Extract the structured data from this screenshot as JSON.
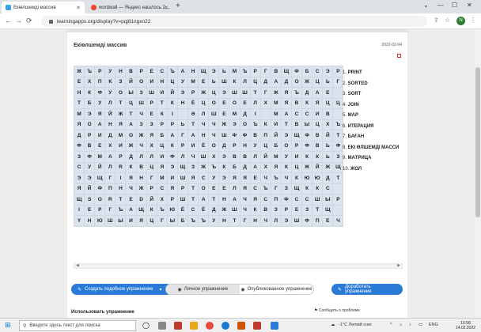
{
  "tabs": [
    {
      "title": "Екiөлшемдi массив",
      "active": true
    },
    {
      "title": "wordwall — Яндекс нашлось 2…",
      "active": false
    }
  ],
  "address": "learningapps.org/display?v=pqj81ngxn22",
  "avatar_letter": "N",
  "exercise": {
    "title": "Екiөлшемдi массив",
    "date": "2022-02-04"
  },
  "grid": [
    [
      "Ж",
      "Ъ",
      "Р",
      "У",
      "Н",
      "В",
      "Р",
      "Е",
      "С",
      "Ъ",
      "А",
      "Н",
      "Щ",
      "Э",
      "Ь",
      "М",
      "Ъ",
      "Р",
      "Г",
      "В",
      "Щ",
      "Ф",
      "Б",
      "С",
      "Э",
      "Р"
    ],
    [
      "Е",
      "Х",
      "П",
      "К",
      "З",
      "Й",
      "О",
      "И",
      "Н",
      "Ц",
      "У",
      "М",
      "Е",
      "Ь",
      "Ш",
      "К",
      "Л",
      "Ц",
      "Д",
      "А",
      "Д",
      "О",
      "Ж",
      "Ц",
      "Ь",
      "Г"
    ],
    [
      "Н",
      "К",
      "Ф",
      "У",
      "О",
      "Ы",
      "З",
      "Ш",
      "И",
      "Й",
      "Э",
      "Р",
      "Ж",
      "Ц",
      "Э",
      "Ш",
      "Ш",
      "Т",
      "Г",
      "Ж",
      "Я",
      "Ъ",
      "Д",
      "А",
      "Е",
      ""
    ],
    [
      "Т",
      "Б",
      "У",
      "Л",
      "Т",
      "Ц",
      "Ш",
      "Р",
      "Т",
      "К",
      "Н",
      "Ё",
      "Ц",
      "О",
      "Е",
      "О",
      "Е",
      "Л",
      "Х",
      "М",
      "Я",
      "В",
      "К",
      "Я",
      "Ц",
      "Ц"
    ],
    [
      "М",
      "Э",
      "Я",
      "Й",
      "Ж",
      "Т",
      "Ч",
      "Е",
      "К",
      "І",
      "",
      "Ә",
      "Л",
      "Ш",
      "Е",
      "М",
      "Д",
      "І",
      "",
      "М",
      "А",
      "С",
      "С",
      "И",
      "В",
      ""
    ],
    [
      "Я",
      "О",
      "А",
      "Н",
      "Я",
      "А",
      "З",
      "З",
      "Р",
      "Р",
      "Ь",
      "Т",
      "Ч",
      "Ч",
      "Ж",
      "Э",
      "О",
      "Ъ",
      "К",
      "И",
      "Т",
      "В",
      "Ы",
      "Ц",
      "Х",
      "Ъ"
    ],
    [
      "Д",
      "Р",
      "И",
      "Д",
      "М",
      "О",
      "Ж",
      "Я",
      "Б",
      "А",
      "Г",
      "А",
      "Н",
      "Ч",
      "Ш",
      "Ф",
      "Ф",
      "В",
      "П",
      "Й",
      "Э",
      "Щ",
      "Ф",
      "В",
      "Й",
      "Т"
    ],
    [
      "Ф",
      "В",
      "Е",
      "Х",
      "И",
      "Ж",
      "Ч",
      "Х",
      "Ц",
      "К",
      "Р",
      "И",
      "Ё",
      "О",
      "Д",
      "Р",
      "Н",
      "У",
      "Ц",
      "Б",
      "О",
      "Р",
      "Ф",
      "В",
      "Ь",
      "Ф"
    ],
    [
      "З",
      "Ф",
      "М",
      "А",
      "Р",
      "Д",
      "Л",
      "Л",
      "И",
      "Ф",
      "Л",
      "Ч",
      "Ш",
      "Х",
      "Э",
      "В",
      "В",
      "Л",
      "Й",
      "М",
      "У",
      "И",
      "К",
      "К",
      "Ь",
      "З"
    ],
    [
      "С",
      "У",
      "Й",
      "Л",
      "R",
      "К",
      "В",
      "Ц",
      "Я",
      "Э",
      "Щ",
      "З",
      "Ж",
      "Ъ",
      "К",
      "Б",
      "Д",
      "А",
      "Х",
      "Я",
      "К",
      "Ц",
      "Ж",
      "Й",
      "Ж",
      "Щ"
    ],
    [
      "Э",
      "Э",
      "Щ",
      "Г",
      "І",
      "Я",
      "Н",
      "Г",
      "М",
      "И",
      "Ш",
      "Я",
      "С",
      "У",
      "Э",
      "Я",
      "Я",
      "Е",
      "Ч",
      "Ъ",
      "Ч",
      "К",
      "Ю",
      "Ю",
      "Д",
      "Т"
    ],
    [
      "Я",
      "Й",
      "Ф",
      "П",
      "Н",
      "Ч",
      "Ж",
      "Р",
      "С",
      "Я",
      "Р",
      "Т",
      "О",
      "Е",
      "Е",
      "Л",
      "Я",
      "С",
      "Ъ",
      "Г",
      "З",
      "Щ",
      "К",
      "К",
      "С",
      ""
    ],
    [
      "Щ",
      "S",
      "O",
      "R",
      "T",
      "E",
      "D",
      "Й",
      "Х",
      "Р",
      "Ш",
      "Т",
      "А",
      "Т",
      "Н",
      "А",
      "Ч",
      "Я",
      "С",
      "П",
      "Ф",
      "С",
      "С",
      "Ш",
      "Ы",
      "Р"
    ],
    [
      "І",
      "Е",
      "Р",
      "Г",
      "Ъ",
      "А",
      "Щ",
      "К",
      "Ъ",
      "Ю",
      "Ё",
      "С",
      "Ё",
      "Д",
      "Ж",
      "Ш",
      "Ч",
      "К",
      "В",
      "З",
      "Р",
      "Е",
      "З",
      "Т",
      "Щ",
      ""
    ],
    [
      "Ү",
      "Н",
      "Ю",
      "Ш",
      "Ы",
      "И",
      "Я",
      "Ц",
      "Г",
      "Ы",
      "Б",
      "Ъ",
      "Ъ",
      "У",
      "Н",
      "Т",
      "Г",
      "Н",
      "Ч",
      "Л",
      "Э",
      "Ш",
      "Ф",
      "П",
      "Е",
      "Ч"
    ]
  ],
  "words": [
    "PRINT",
    "SORTED",
    "SORT",
    "JOIN",
    "MAP",
    "ИТЕРАЦИЯ",
    "БАҒАН",
    "ЕКІ ӨЛШЕМДІ МАССИ",
    "МАТРИЦА",
    "ЖОЛ"
  ],
  "buttons": {
    "create": "Создать подобное упражнение",
    "private": "Личное упражнение",
    "published": "Опубликованное упражнение",
    "improve": "Доработать упражнение"
  },
  "use_title": "Использовать упражнение",
  "report": "Сообщить о проблеме",
  "taskbar": {
    "search_placeholder": "Введите здесь текст для поиска",
    "weather": "-1°С Легкий снег",
    "lang": "ENG",
    "time": "10:58",
    "date": "14.02.2022"
  },
  "colors": {
    "accent": "#2a7bd8",
    "cell": "#d9e4ee"
  }
}
